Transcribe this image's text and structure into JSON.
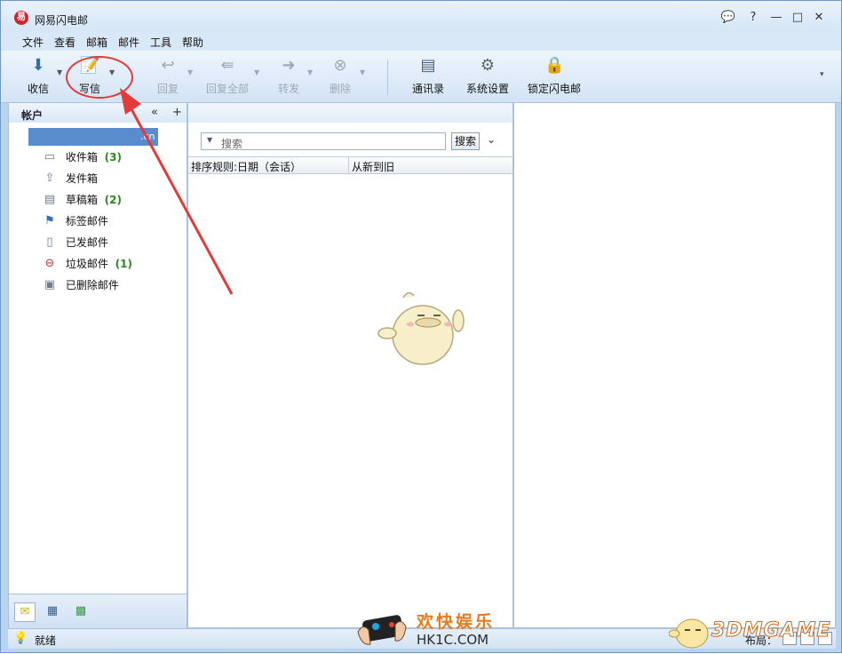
{
  "window": {
    "title": "网易闪电邮",
    "app_icon_glyph": "易"
  },
  "menu": [
    "文件",
    "查看",
    "邮箱",
    "邮件",
    "工具",
    "帮助"
  ],
  "toolbar": {
    "receive": "收信",
    "compose": "写信",
    "reply": "回复",
    "reply_all": "回复全部",
    "forward": "转发",
    "delete": "删除",
    "contacts": "通讯录",
    "settings": "系统设置",
    "lock": "锁定闪电邮"
  },
  "left_pane": {
    "header": "帐户",
    "account_suffix": ".cn",
    "folders": [
      {
        "label": "收件箱",
        "count": "(3)",
        "icon": "inbox-icon"
      },
      {
        "label": "发件箱",
        "count": "",
        "icon": "outbox-icon"
      },
      {
        "label": "草稿箱",
        "count": "(2)",
        "icon": "drafts-icon"
      },
      {
        "label": "标签邮件",
        "count": "",
        "icon": "flag-icon"
      },
      {
        "label": "已发邮件",
        "count": "",
        "icon": "sent-icon"
      },
      {
        "label": "垃圾邮件",
        "count": "(1)",
        "icon": "spam-icon"
      },
      {
        "label": "已删除邮件",
        "count": "",
        "icon": "trash-icon"
      }
    ]
  },
  "mid_pane": {
    "search_placeholder": "搜索",
    "search_button": "搜索",
    "sort_rule": "排序规则:日期（会话）",
    "sort_order": "从新到旧"
  },
  "status": {
    "text": "就绪",
    "layout_label": "布局："
  },
  "watermarks": {
    "hk_cn": "欢快娱乐",
    "hk_en": "HK1C.COM",
    "brand": "3DMGAME"
  },
  "colors": {
    "accent": "#3c79c6",
    "highlight": "#e23b3b",
    "count": "#2a8a1e"
  }
}
